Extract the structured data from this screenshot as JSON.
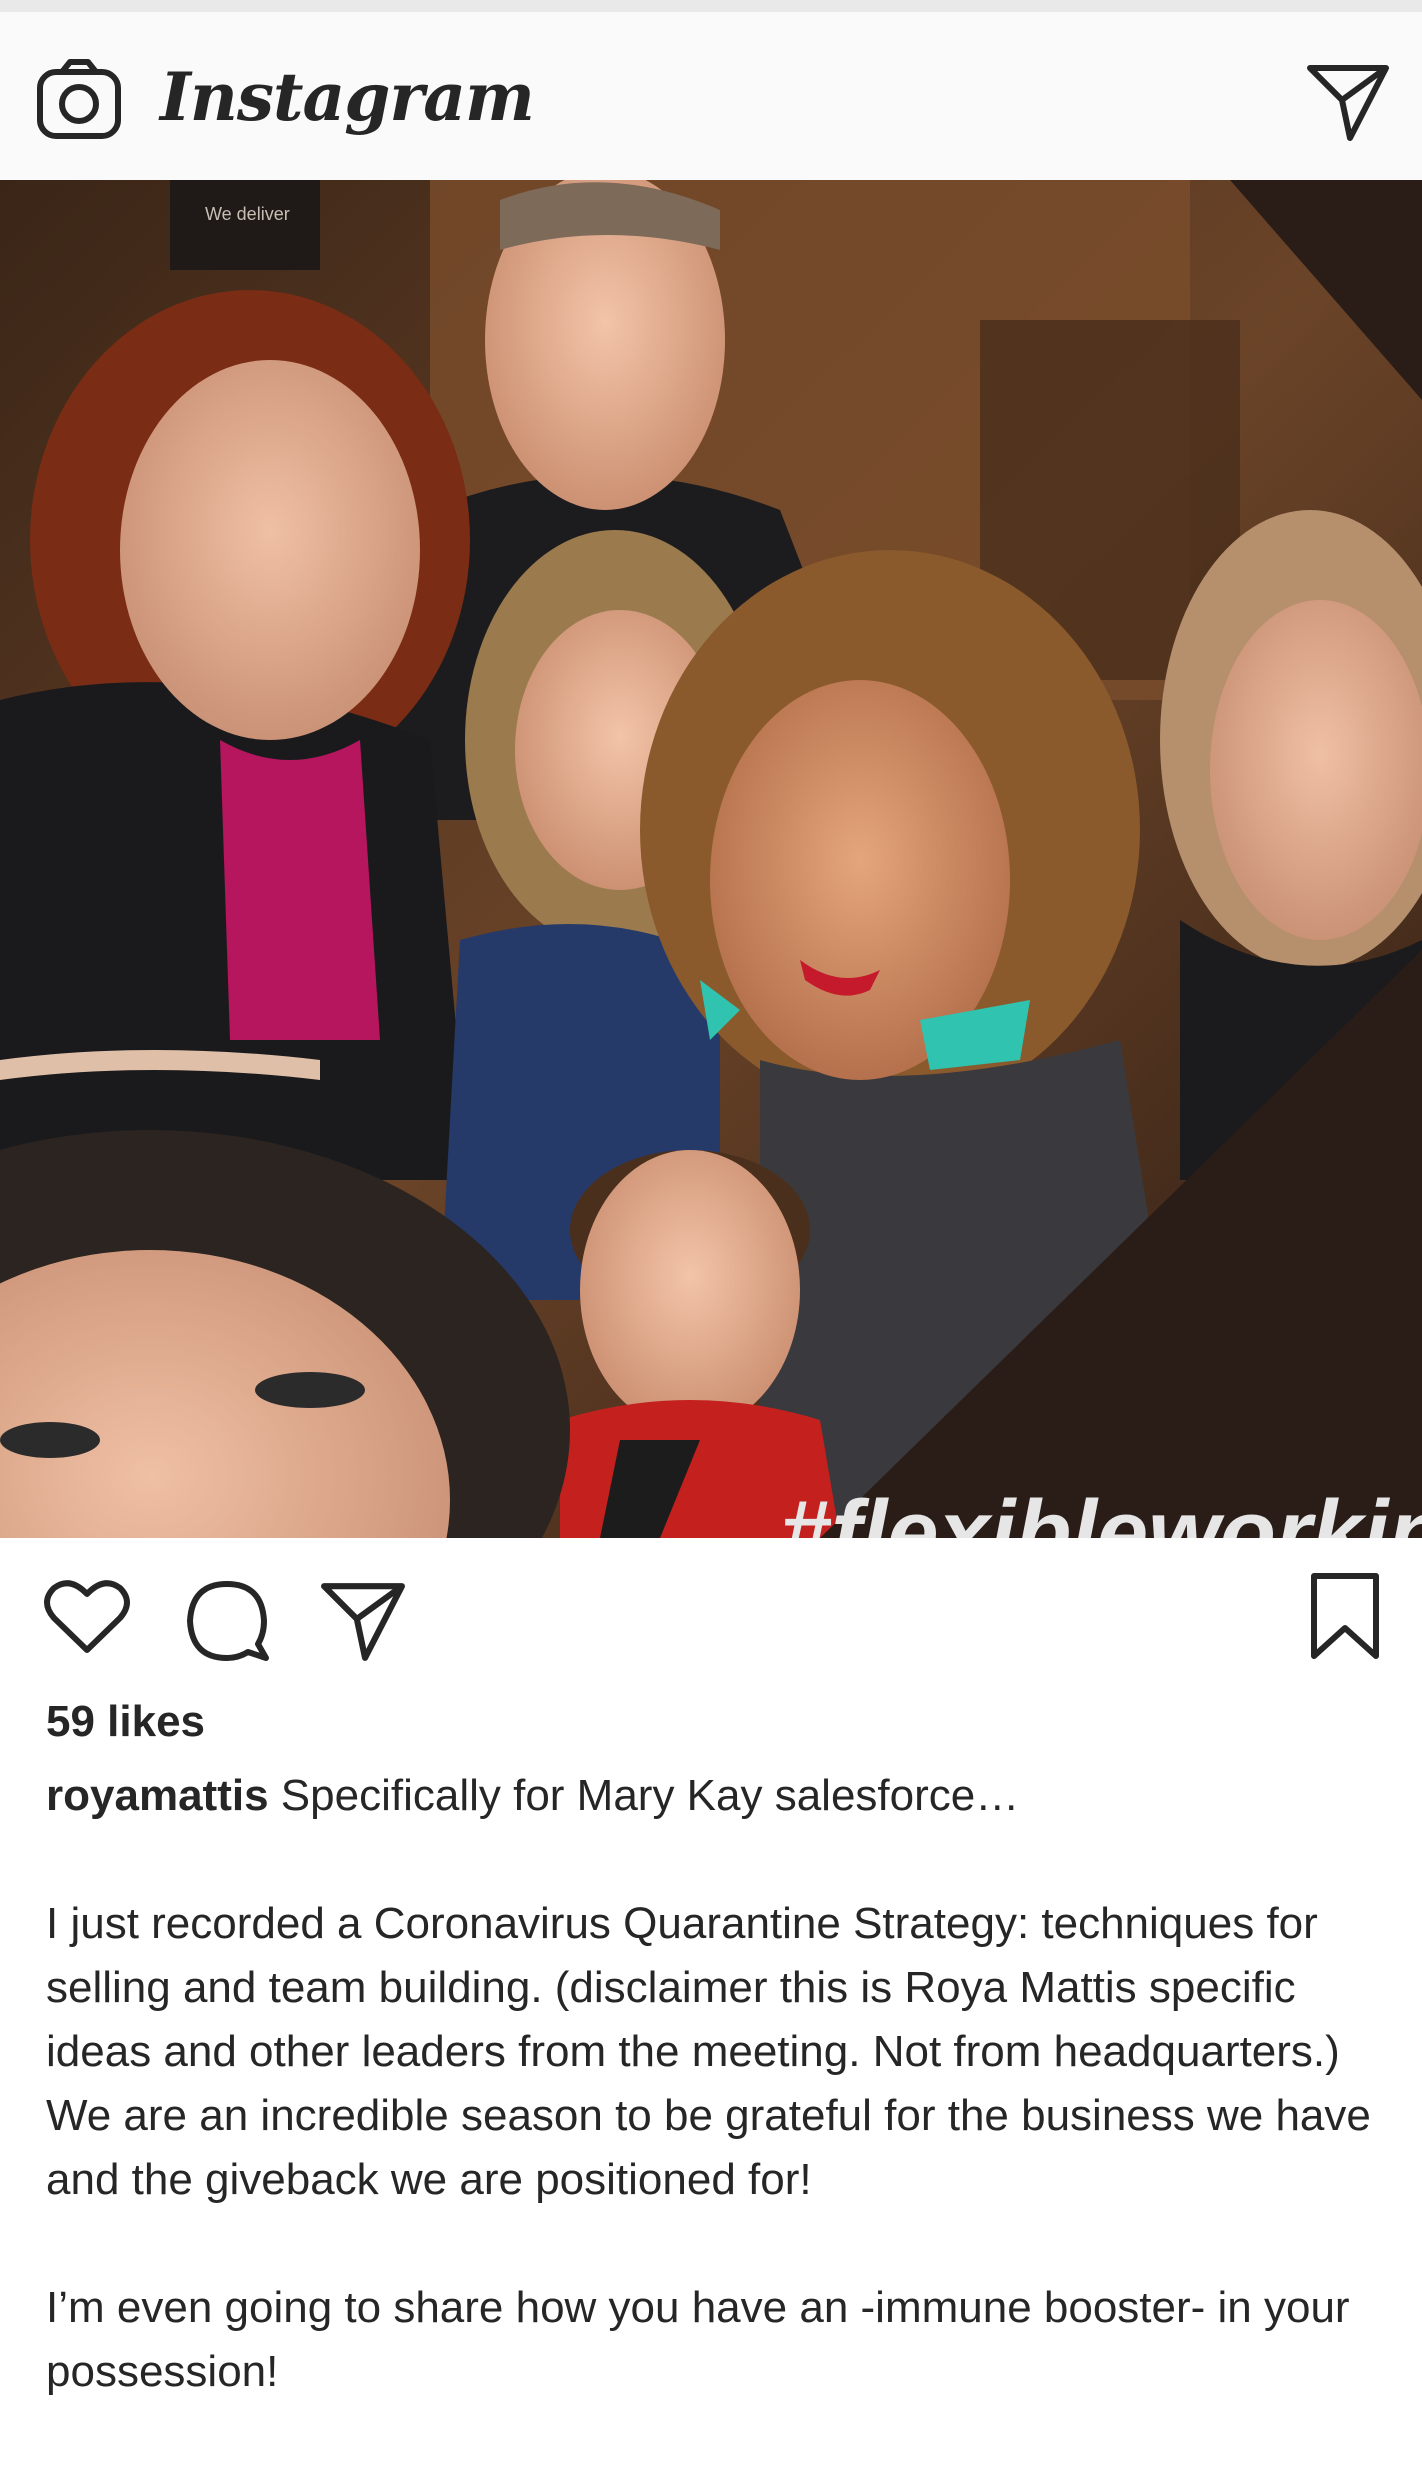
{
  "header": {
    "brand": "Instagram",
    "camera_icon": "camera-icon",
    "direct_icon": "paper-plane-icon"
  },
  "post": {
    "image_overlay_text": "#flexibleworking",
    "image_sign_text": "We deliver",
    "actions": {
      "like_icon": "heart-icon",
      "comment_icon": "comment-bubble-icon",
      "share_icon": "paper-plane-icon",
      "save_icon": "bookmark-icon"
    },
    "likes": "59 likes",
    "username": "royamattis",
    "caption_first_line": "Specifically for Mary Kay salesforce…",
    "caption_paragraphs": [
      "I just recorded a Coronavirus Quarantine Strategy: techniques for selling and team building. (disclaimer this is Roya Mattis specific ideas and other leaders from the meeting. Not from headquarters.) We are an incredible season to be grateful for the business we have and the giveback we are positioned for!",
      "I’m even going to share how you have an -immune booster- in your possession!"
    ]
  },
  "colors": {
    "text": "#262626",
    "header_bg": "#fafafa",
    "overlay_frame": "#2a1d17"
  }
}
